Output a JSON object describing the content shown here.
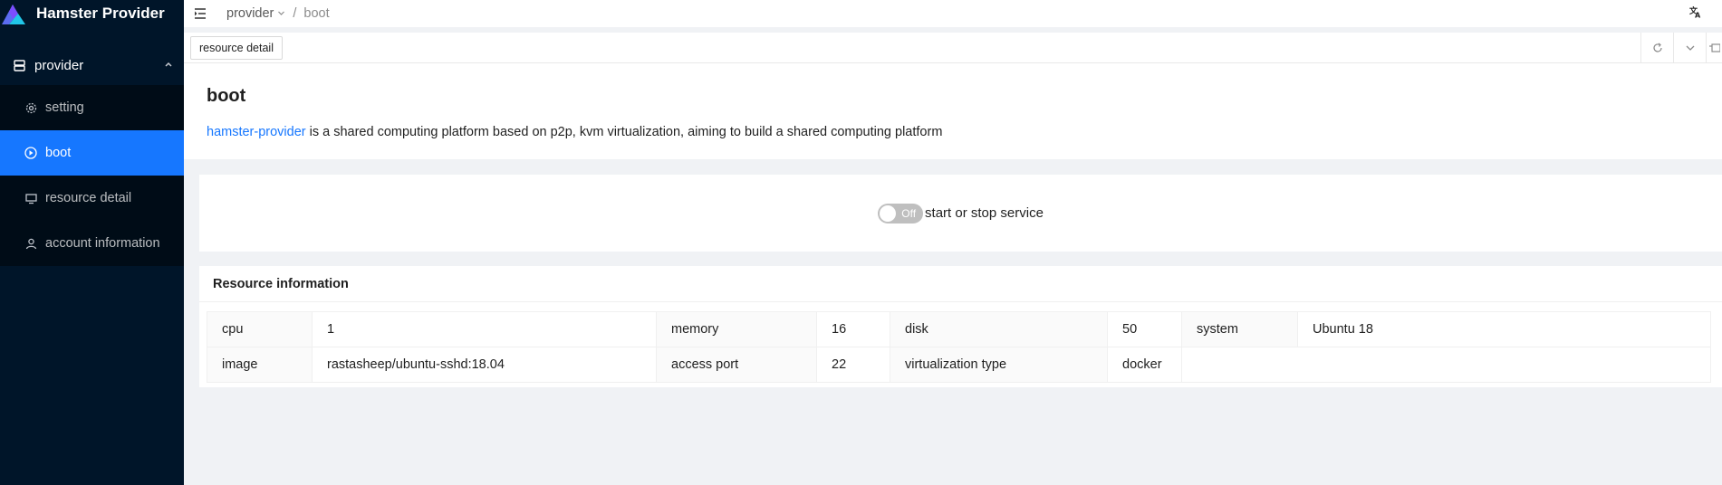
{
  "app": {
    "title": "Hamster Provider"
  },
  "sidebar": {
    "group_label": "provider",
    "items": [
      {
        "label": "setting"
      },
      {
        "label": "boot"
      },
      {
        "label": "resource detail"
      },
      {
        "label": "account information"
      }
    ]
  },
  "header": {
    "breadcrumb_root": "provider",
    "breadcrumb_separator": "/",
    "breadcrumb_current": "boot"
  },
  "tabs": {
    "active_tab": "resource detail"
  },
  "page": {
    "title": "boot",
    "link_text": "hamster-provider",
    "description_rest": " is a shared computing platform based on p2p, kvm virtualization, aiming to build a shared computing platform"
  },
  "service": {
    "switch_text": "Off",
    "switch_on": false,
    "label": "start or stop service"
  },
  "resource": {
    "title": "Resource information",
    "rows": [
      [
        {
          "label": "cpu",
          "value": "1"
        },
        {
          "label": "memory",
          "value": "16"
        },
        {
          "label": "disk",
          "value": "50"
        },
        {
          "label": "system",
          "value": "Ubuntu 18"
        }
      ],
      [
        {
          "label": "image",
          "value": "rastasheep/ubuntu-sshd:18.04"
        },
        {
          "label": "access port",
          "value": "22"
        },
        {
          "label": "virtualization type",
          "value": "docker"
        }
      ]
    ]
  },
  "colors": {
    "sidebar_bg": "#001529",
    "active_item": "#1677ff",
    "link": "#1677ff"
  }
}
